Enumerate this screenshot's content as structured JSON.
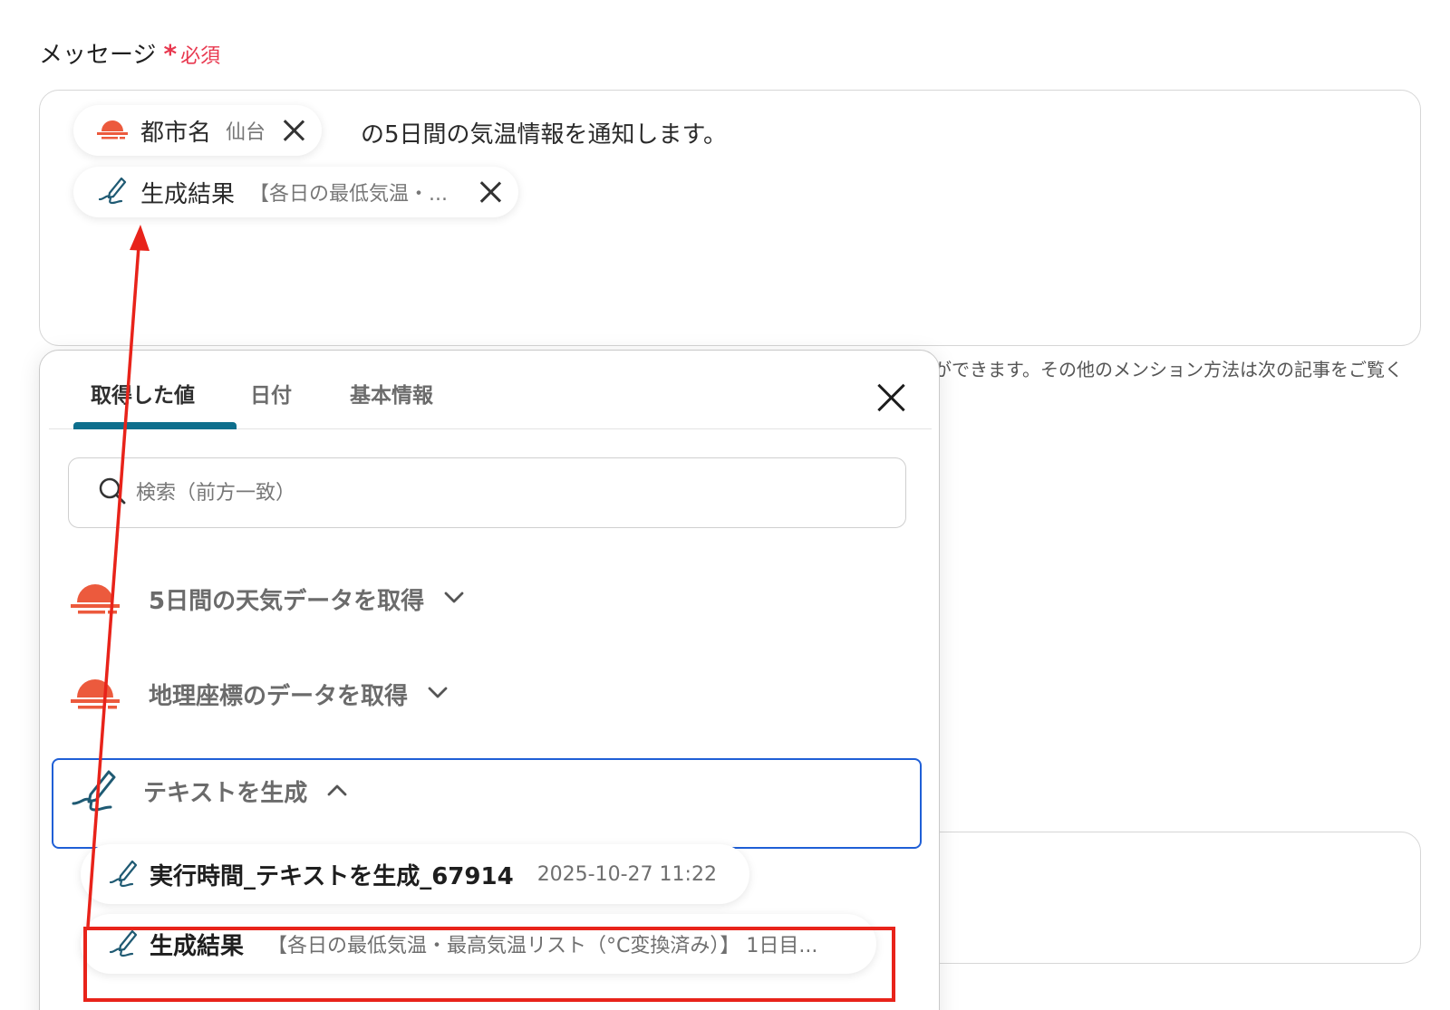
{
  "field": {
    "label": "メッセージ",
    "required_star": "*",
    "required_text": "必須"
  },
  "message": {
    "chip_city": {
      "name": "都市名",
      "value": "仙台",
      "icon": "weather-sun-icon"
    },
    "text": "の5日間の気温情報を通知します。",
    "chip_result": {
      "name": "生成結果",
      "value": "【各日の最低気温・...",
      "icon": "pen-icon"
    }
  },
  "help_text": "ができます。その他のメンション方法は次の記事をご覧く",
  "panel": {
    "tabs": [
      "取得した値",
      "日付",
      "基本情報"
    ],
    "active_tab": 0,
    "search_placeholder": "検索（前方一致）",
    "groups": [
      {
        "label": "5日間の天気データを取得",
        "icon": "weather-sun-icon",
        "expanded": false
      },
      {
        "label": "地理座標のデータを取得",
        "icon": "weather-sun-icon",
        "expanded": false
      },
      {
        "label": "テキストを生成",
        "icon": "pen-icon",
        "expanded": true
      }
    ],
    "items": [
      {
        "name": "実行時間_テキストを生成_67914",
        "value": "2025-10-27 11:22",
        "icon": "pen-icon"
      },
      {
        "name": "生成結果",
        "value": "【各日の最低気温・最高気温リスト（°C変換済み）】 1日目...",
        "icon": "pen-icon"
      }
    ]
  },
  "colors": {
    "required": "#e8384f",
    "weather_icon": "#ec5a3d",
    "pen_icon": "#1f5a73",
    "tab_indicator": "#0e6f8d",
    "selected_border": "#1f5fd6",
    "annotation": "#e8231a"
  }
}
